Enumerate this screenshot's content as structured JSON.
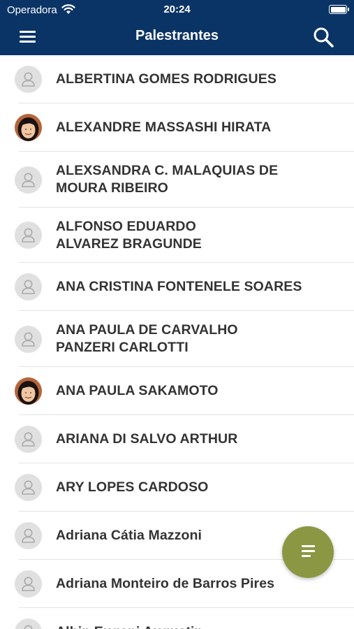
{
  "status_bar": {
    "carrier": "Operadora",
    "time": "20:24"
  },
  "header": {
    "title": "Palestrantes",
    "menu_icon": "hamburger-menu-icon",
    "search_icon": "search-icon"
  },
  "speakers": [
    {
      "name": "ALBERTINA GOMES RODRIGUES",
      "photo": false
    },
    {
      "name": "ALEXANDRE MASSASHI HIRATA",
      "photo": true
    },
    {
      "name": "ALEXSANDRA C. MALAQUIAS DE MOURA RIBEIRO",
      "photo": false
    },
    {
      "name": "ALFONSO EDUARDO ALVAREZ BRAGUNDE",
      "photo": false
    },
    {
      "name": "ANA CRISTINA FONTENELE SOARES",
      "photo": false
    },
    {
      "name": "ANA PAULA DE CARVALHO PANZERI CARLOTTI",
      "photo": false
    },
    {
      "name": "ANA PAULA SAKAMOTO",
      "photo": true
    },
    {
      "name": "ARIANA DI SALVO ARTHUR",
      "photo": false
    },
    {
      "name": "ARY LOPES CARDOSO",
      "photo": false
    },
    {
      "name": "Adriana Cátia Mazzoni",
      "photo": false
    },
    {
      "name": "Adriana Monteiro de Barros Pires",
      "photo": false
    },
    {
      "name": "Albin Eugeni Augustin",
      "photo": false
    }
  ],
  "fab": {
    "icon": "filter-list-icon"
  },
  "colors": {
    "header_bg": "#0b3466",
    "fab_bg": "#8c9743",
    "text": "#333333"
  }
}
